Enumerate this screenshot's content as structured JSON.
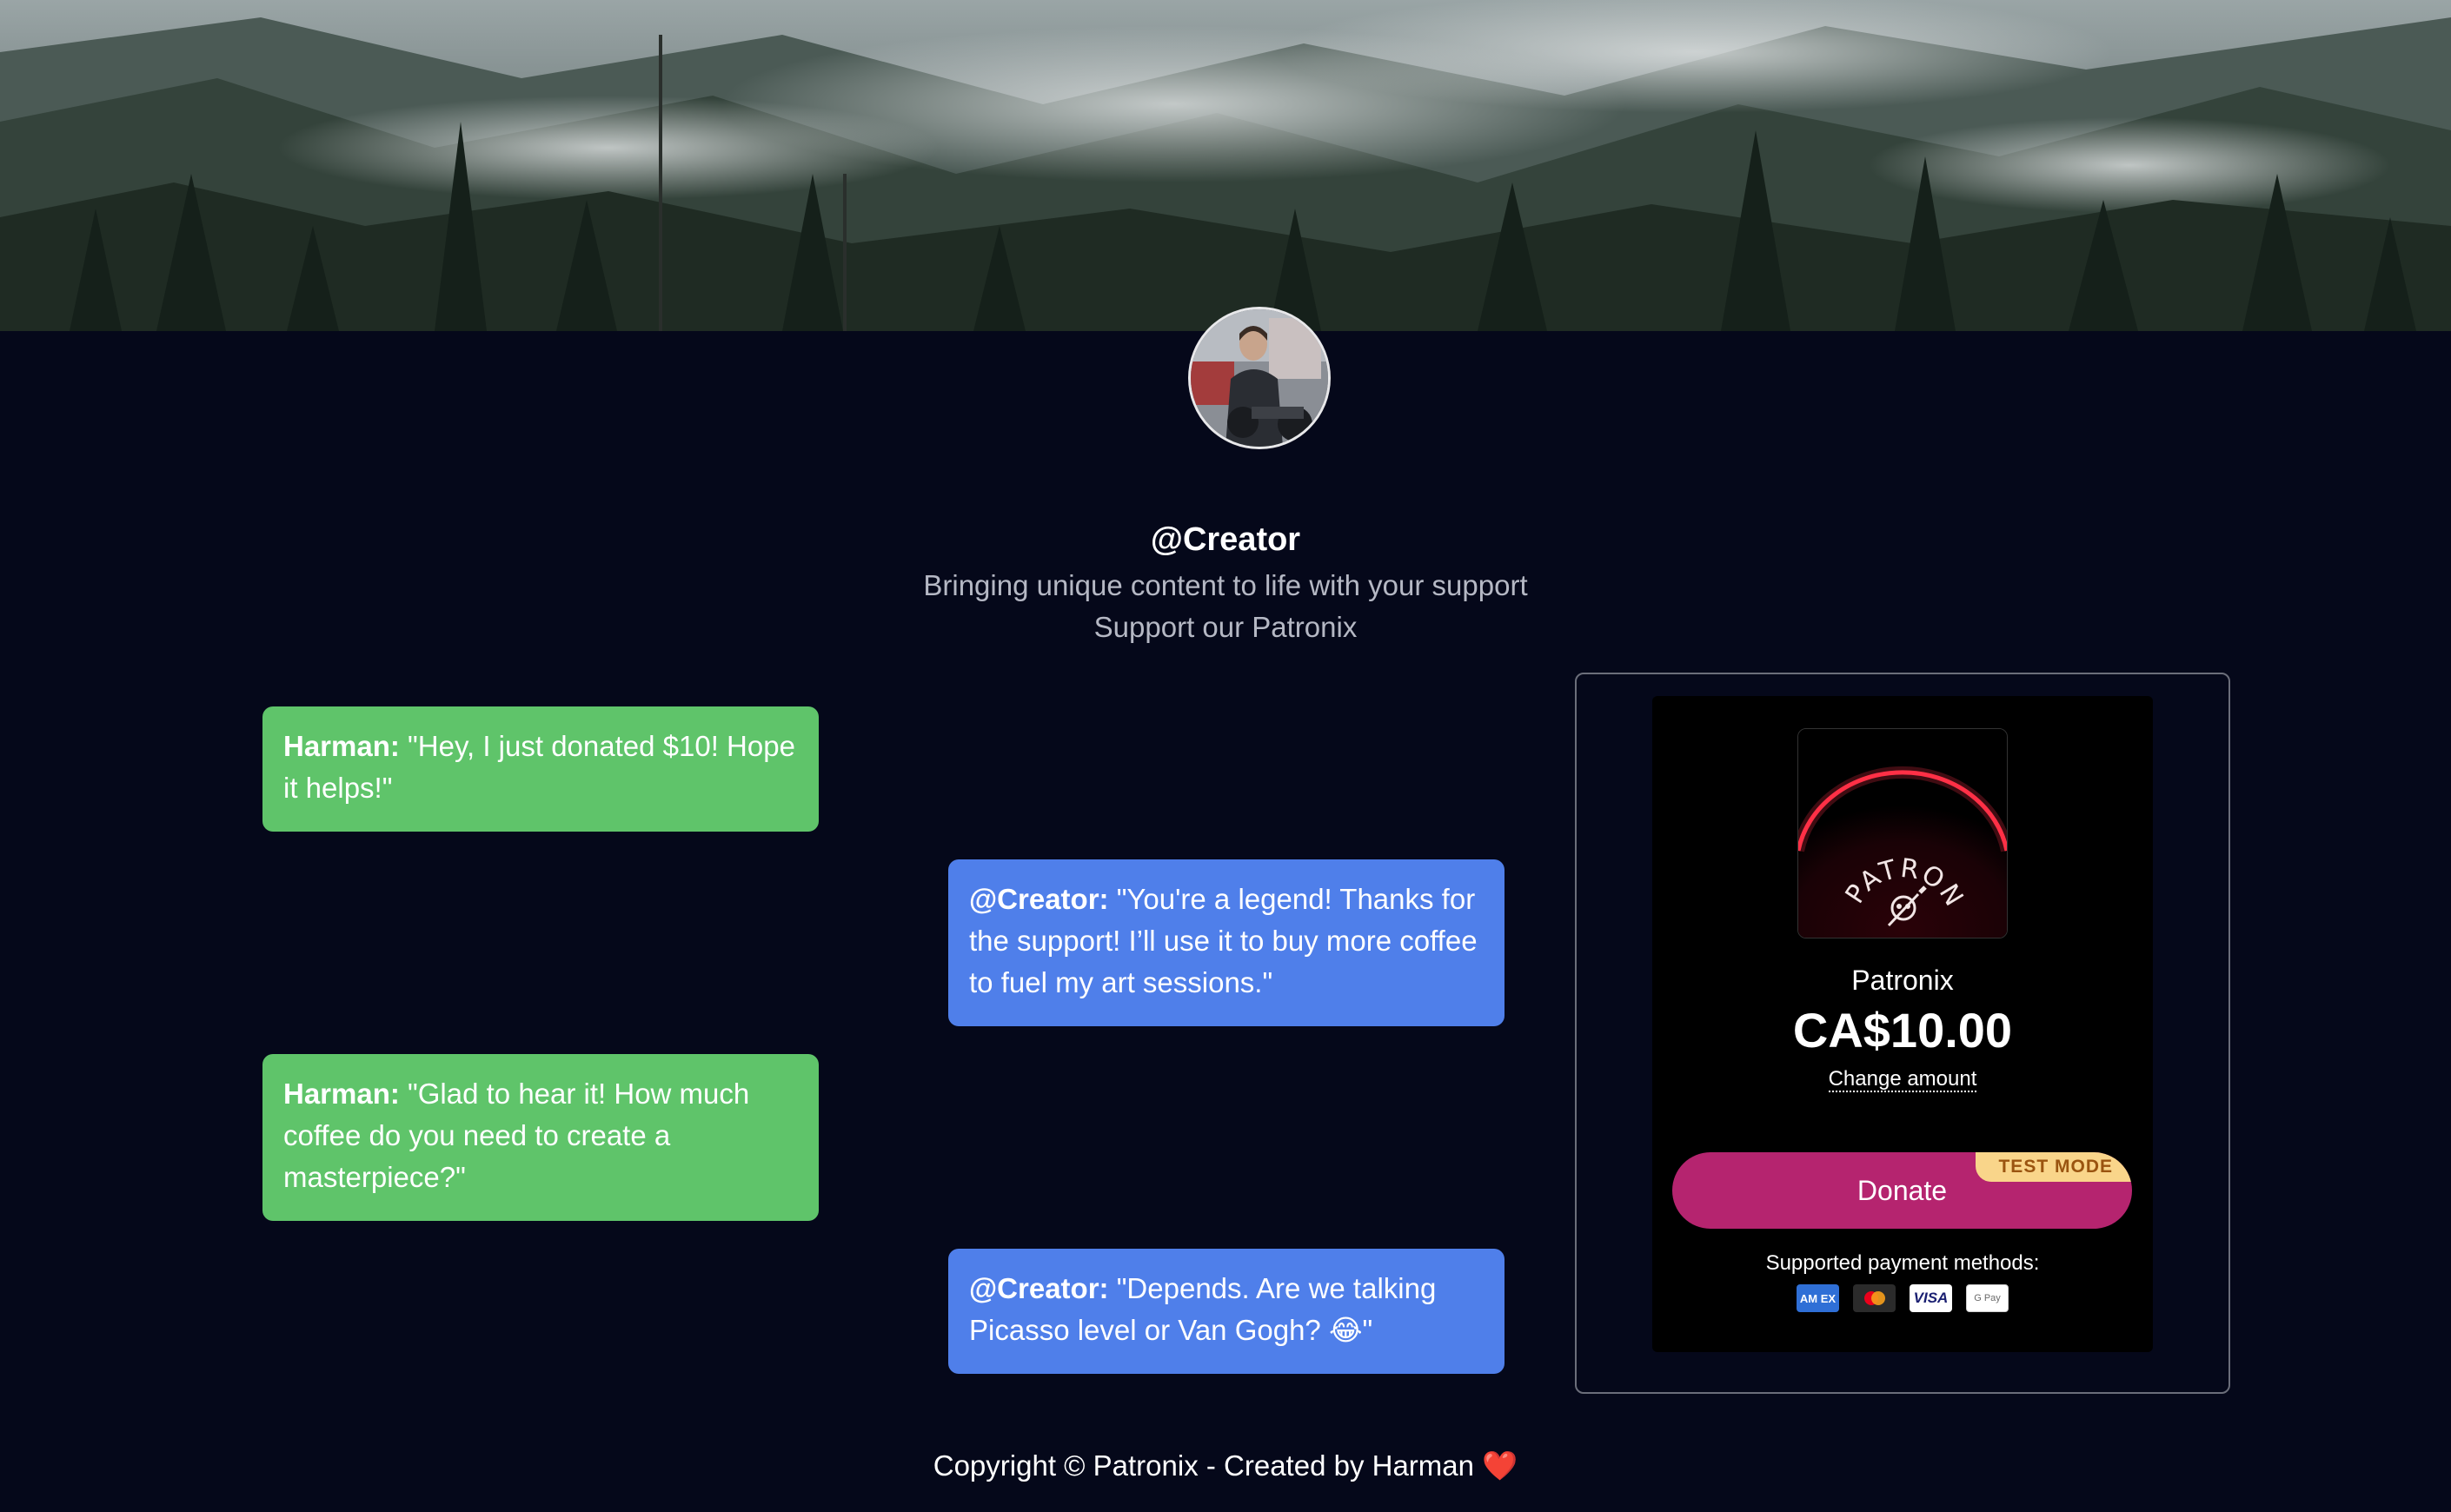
{
  "profile": {
    "handle": "@Creator",
    "tagline": "Bringing unique content to life with your support",
    "subline": "Support our Patronix"
  },
  "chat": [
    {
      "speaker": "Harman:",
      "text": " \"Hey, I just donated $10! Hope it helps!\"",
      "color": "#5fc46a"
    },
    {
      "speaker": "@Creator:",
      "text": " \"You're a legend! Thanks for the support! I’ll use it to buy more coffee to fuel my art sessions.\"",
      "color": "#4f7fea"
    },
    {
      "speaker": "Harman:",
      "text": " \"Glad to hear it! How much coffee do you need to create a masterpiece?\"",
      "color": "#5fc46a"
    },
    {
      "speaker": "@Creator:",
      "text": " \"Depends. Are we talking Picasso level or Van Gogh? 😂\"",
      "color": "#4f7fea"
    }
  ],
  "payment": {
    "logo_text": "PATRONIX",
    "product_name": "Patronix",
    "price": "CA$10.00",
    "change_amount": "Change amount",
    "donate_label": "Donate",
    "test_mode_label": "TEST MODE",
    "methods_label": "Supported payment methods:",
    "methods": [
      {
        "name": "amex-icon",
        "label": "AM EX"
      },
      {
        "name": "mastercard-icon",
        "label": ""
      },
      {
        "name": "visa-icon",
        "label": "VISA"
      },
      {
        "name": "google-pay-icon",
        "label": "G Pay"
      }
    ],
    "donate_color": "#b5246f"
  },
  "footer": {
    "text": "Copyright © Patronix - Created by Harman",
    "heart": "❤️"
  }
}
